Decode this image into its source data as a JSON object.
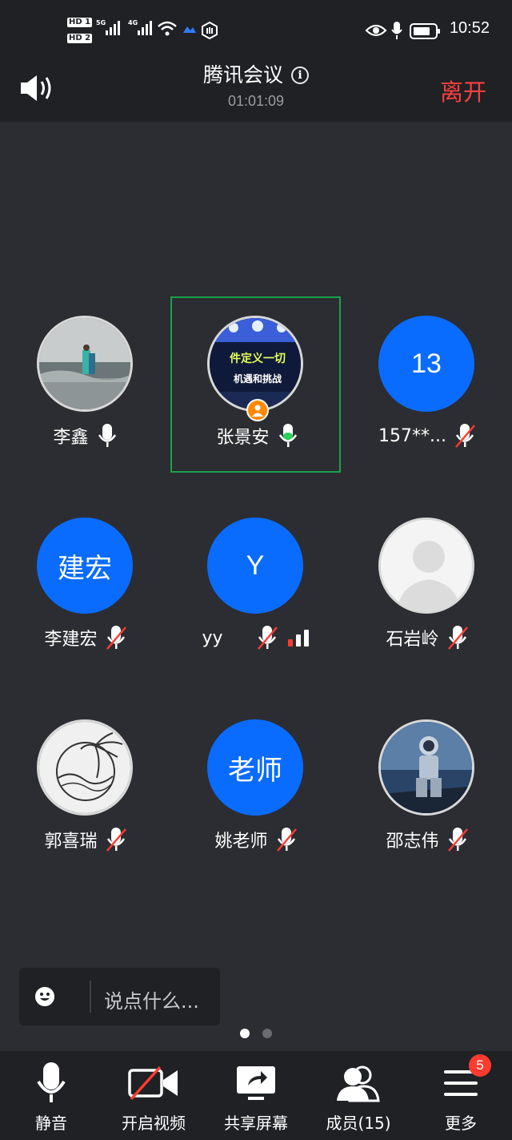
{
  "status": {
    "hd1": "HD 1",
    "hd2": "HD 2",
    "net1": "5G",
    "net2": "4G",
    "time": "10:52"
  },
  "header": {
    "title": "腾讯会议",
    "duration": "01:01:09",
    "leave_label": "离开"
  },
  "participants": [
    {
      "name": "李鑫",
      "avatar_type": "photo",
      "mic": "on"
    },
    {
      "name": "张景安",
      "avatar_type": "photo",
      "mic": "speaking",
      "host": true,
      "avatar_text_line1": "件定义一切",
      "avatar_text_line2": "机遇和挑战"
    },
    {
      "name": "157**...",
      "avatar_type": "initials",
      "avatar_text": "13",
      "mic": "muted"
    },
    {
      "name": "李建宏",
      "avatar_type": "initials",
      "avatar_text": "建宏",
      "mic": "muted"
    },
    {
      "name": "yy",
      "avatar_type": "initials",
      "avatar_text": "Y",
      "mic": "muted",
      "weak_signal": true
    },
    {
      "name": "石岩岭",
      "avatar_type": "default",
      "mic": "muted"
    },
    {
      "name": "郭喜瑞",
      "avatar_type": "photo",
      "mic": "muted"
    },
    {
      "name": "姚老师",
      "avatar_type": "initials",
      "avatar_text": "老师",
      "mic": "muted"
    },
    {
      "name": "邵志伟",
      "avatar_type": "photo",
      "mic": "muted"
    }
  ],
  "chat": {
    "placeholder": "说点什么..."
  },
  "pagination": {
    "current": 1,
    "total": 2
  },
  "toolbar": {
    "mute_label": "静音",
    "video_label": "开启视频",
    "share_label": "共享屏幕",
    "members_label": "成员(15)",
    "more_label": "更多",
    "more_badge": "5"
  },
  "colors": {
    "accent_blue": "#0a6cff",
    "leave_red": "#ff4040",
    "speaking_green": "#1aa14a",
    "host_orange": "#ff8a00"
  }
}
